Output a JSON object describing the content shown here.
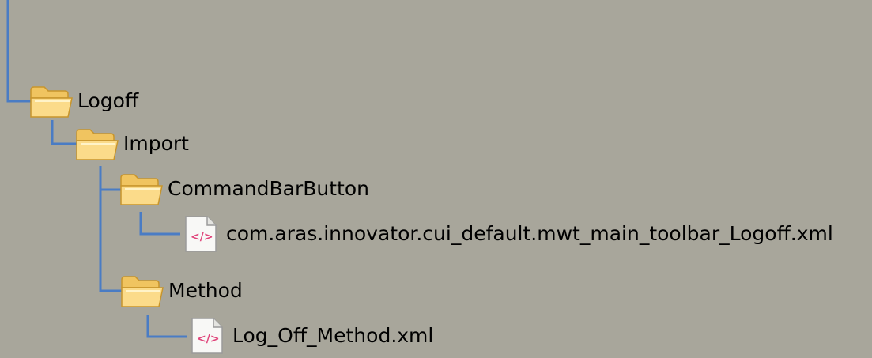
{
  "tree": {
    "nodes": [
      {
        "label": "Logoff",
        "type": "folder",
        "icon": "folder-open-icon"
      },
      {
        "label": "Import",
        "type": "folder",
        "icon": "folder-open-icon"
      },
      {
        "label": "CommandBarButton",
        "type": "folder",
        "icon": "folder-open-icon"
      },
      {
        "label": "com.aras.innovator.cui_default.mwt_main_toolbar_Logoff.xml",
        "type": "file",
        "icon": "xml-file-icon"
      },
      {
        "label": "Method",
        "type": "folder",
        "icon": "folder-open-icon"
      },
      {
        "label": "Log_Off_Method.xml",
        "type": "file",
        "icon": "xml-file-icon"
      }
    ]
  },
  "colors": {
    "background": "#a8a69b",
    "connector": "#4a7cc4",
    "folder": "#f5c75a",
    "xml_tag": "#e0457b"
  }
}
